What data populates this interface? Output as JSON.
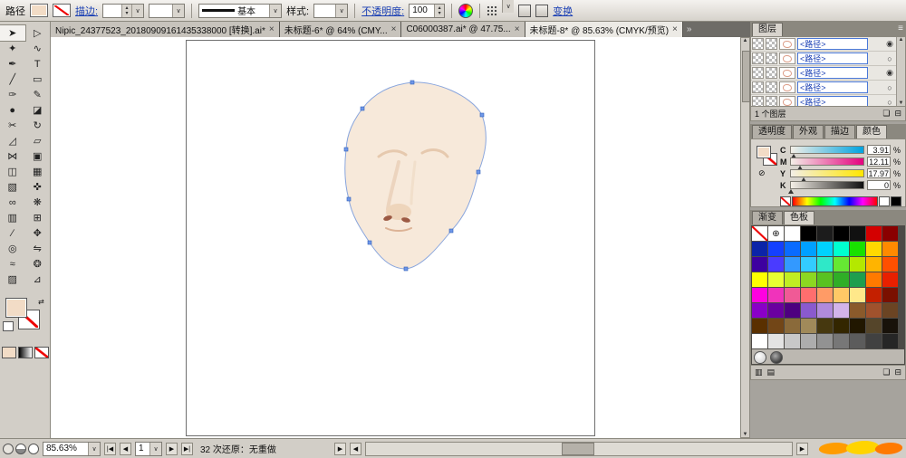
{
  "control_bar": {
    "context_label": "路径",
    "fill_color": "#f2dcc6",
    "stroke_link": "描边:",
    "brush_name": "基本",
    "style_label": "样式:",
    "opacity_link": "不透明度:",
    "opacity_value": "100",
    "transform_link": "变换"
  },
  "tab_bar": {
    "tabs": [
      {
        "label": "Nipic_24377523_20180909161435338000  [转换].ai*"
      },
      {
        "label": "未标题-6* @ 64% (CMY..."
      },
      {
        "label": "C06000387.ai* @ 47.75..."
      }
    ],
    "active_tab": {
      "label": "未标题-8* @ 85.63% (CMYK/预览)"
    }
  },
  "toolbox": {
    "tools": [
      {
        "name": "selection-tool",
        "glyph": "➤"
      },
      {
        "name": "direct-selection-tool",
        "glyph": "▷"
      },
      {
        "name": "magic-wand-tool",
        "glyph": "✦"
      },
      {
        "name": "lasso-tool",
        "glyph": "∿"
      },
      {
        "name": "pen-tool",
        "glyph": "✒"
      },
      {
        "name": "type-tool",
        "glyph": "T"
      },
      {
        "name": "line-tool",
        "glyph": "╱"
      },
      {
        "name": "rectangle-tool",
        "glyph": "▭"
      },
      {
        "name": "paintbrush-tool",
        "glyph": "✑"
      },
      {
        "name": "pencil-tool",
        "glyph": "✎"
      },
      {
        "name": "blob-brush-tool",
        "glyph": "●"
      },
      {
        "name": "eraser-tool",
        "glyph": "◪"
      },
      {
        "name": "scissors-tool",
        "glyph": "✂"
      },
      {
        "name": "rotate-tool",
        "glyph": "↻"
      },
      {
        "name": "scale-tool",
        "glyph": "◿"
      },
      {
        "name": "shear-tool",
        "glyph": "▱"
      },
      {
        "name": "width-tool",
        "glyph": "⋈"
      },
      {
        "name": "free-transform-tool",
        "glyph": "▣"
      },
      {
        "name": "shape-builder-tool",
        "glyph": "◫"
      },
      {
        "name": "mesh-tool",
        "glyph": "▦"
      },
      {
        "name": "gradient-tool",
        "glyph": "▧"
      },
      {
        "name": "eyedropper-tool",
        "glyph": "✜"
      },
      {
        "name": "blend-tool",
        "glyph": "∞"
      },
      {
        "name": "symbol-sprayer-tool",
        "glyph": "❋"
      },
      {
        "name": "graph-tool",
        "glyph": "▥"
      },
      {
        "name": "artboard-tool",
        "glyph": "⊞"
      },
      {
        "name": "slice-tool",
        "glyph": "∕"
      },
      {
        "name": "hand-tool",
        "glyph": "✥"
      },
      {
        "name": "zoom-tool",
        "glyph": "◎"
      },
      {
        "name": "reflect-tool",
        "glyph": "⇋"
      },
      {
        "name": "warp-tool",
        "glyph": "≈"
      },
      {
        "name": "twirl-tool",
        "glyph": "❂"
      },
      {
        "name": "live-paint-tool",
        "glyph": "▨"
      },
      {
        "name": "perspective-grid-tool",
        "glyph": "⊿"
      }
    ]
  },
  "layers": {
    "tab": "图层",
    "rows": [
      {
        "label": "<路径>",
        "target": "◉"
      },
      {
        "label": "<路径>",
        "target": "○"
      },
      {
        "label": "<路径>",
        "target": "◉"
      },
      {
        "label": "<路径>",
        "target": "○"
      },
      {
        "label": "<路径>",
        "target": "○"
      }
    ],
    "footer": "1 个图层"
  },
  "panel_tabs": {
    "transparency": "透明度",
    "appearance": "外观",
    "stroke": "描边",
    "color": "颜色",
    "gradient": "渐变",
    "swatches": "色板"
  },
  "color_panel": {
    "fill_color": "#f2dcc6",
    "sliders": [
      {
        "ch": "C",
        "value": "3.91",
        "unit": "%"
      },
      {
        "ch": "M",
        "value": "12.11",
        "unit": "%"
      },
      {
        "ch": "Y",
        "value": "17.97",
        "unit": "%"
      },
      {
        "ch": "K",
        "value": "0",
        "unit": "%"
      }
    ]
  },
  "swatches": {
    "cells": [
      "#ffffff",
      "#000000",
      "#1c1c1c",
      "#000000",
      "#111111",
      "#d40000",
      "#8a0000",
      "#0b24a8",
      "#1440ff",
      "#0a6bff",
      "#00a0ff",
      "#00d2ff",
      "#00ffd0",
      "#19e000",
      "#ffd900",
      "#ff8a00",
      "#3d00a0",
      "#4a3bff",
      "#3399ff",
      "#33ccff",
      "#2fe8c8",
      "#66e833",
      "#b4e800",
      "#ffb400",
      "#ff5000",
      "#ffff00",
      "#e8ff33",
      "#c0ee22",
      "#8cd821",
      "#59c221",
      "#2fae27",
      "#1f9e4e",
      "#ff7a00",
      "#e82000",
      "#ff00e0",
      "#f033bb",
      "#f05a96",
      "#ff6e6e",
      "#ff9b66",
      "#ffc966",
      "#ffe88a",
      "#c42000",
      "#7a1000",
      "#8a00c8",
      "#6a00a0",
      "#4e0080",
      "#8a5ace",
      "#b08adc",
      "#d2b4ea",
      "#8a5a2b",
      "#a0522d",
      "#6b4423",
      "#5a3000",
      "#724617",
      "#8a6a3a",
      "#a08a5a",
      "#46380f",
      "#332600",
      "#211700",
      "#55452a",
      "#18120a",
      "#ffffff",
      "#e3e3e3",
      "#c8c8c8",
      "#adadad",
      "#929292",
      "#777777",
      "#5c5c5c",
      "#414141",
      "#262626"
    ]
  },
  "status_bar": {
    "zoom": "85.63%",
    "page": "1",
    "undo_text": "32 次还原：无重做"
  },
  "icons": {
    "chevron_down": "∨",
    "spin_up": "▴",
    "spin_down": "▾",
    "close": "×",
    "overflow": "»",
    "panel_menu": "≡",
    "scroll_up": "▲",
    "scroll_down": "▼",
    "nav_first": "|◀",
    "nav_prev": "◀",
    "nav_next": "▶",
    "nav_last": "▶|",
    "status_play": "▶",
    "registration": "⊕",
    "new_item": "❏",
    "delete_item": "⊟",
    "folder": "▤",
    "libraries": "▥",
    "none": "⊘",
    "swap": "⇄"
  }
}
